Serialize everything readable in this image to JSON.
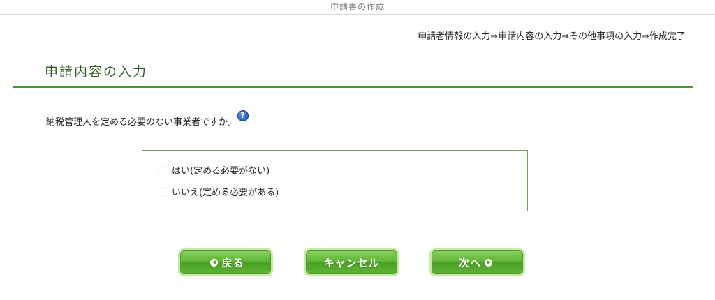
{
  "window": {
    "title": "申請書の作成"
  },
  "steps": {
    "before": "申請者情報の入力⇒",
    "current": "申請内容の入力",
    "after": "⇒その他事項の入力⇒作成完了"
  },
  "page": {
    "heading": "申請内容の入力",
    "question": "納税管理人を定める必要のない事業者ですか。",
    "help_icon_text": "?"
  },
  "options": [
    {
      "label": "はい(定める必要がない)"
    },
    {
      "label": "いいえ(定める必要がある)"
    }
  ],
  "buttons": {
    "back": "戻る",
    "cancel": "キャンセル",
    "next": "次へ"
  },
  "colors": {
    "accent_green": "#3f9a2a",
    "heading_green": "#2f5f22",
    "button_green": "#5bb234",
    "help_blue": "#1a4fb8"
  }
}
